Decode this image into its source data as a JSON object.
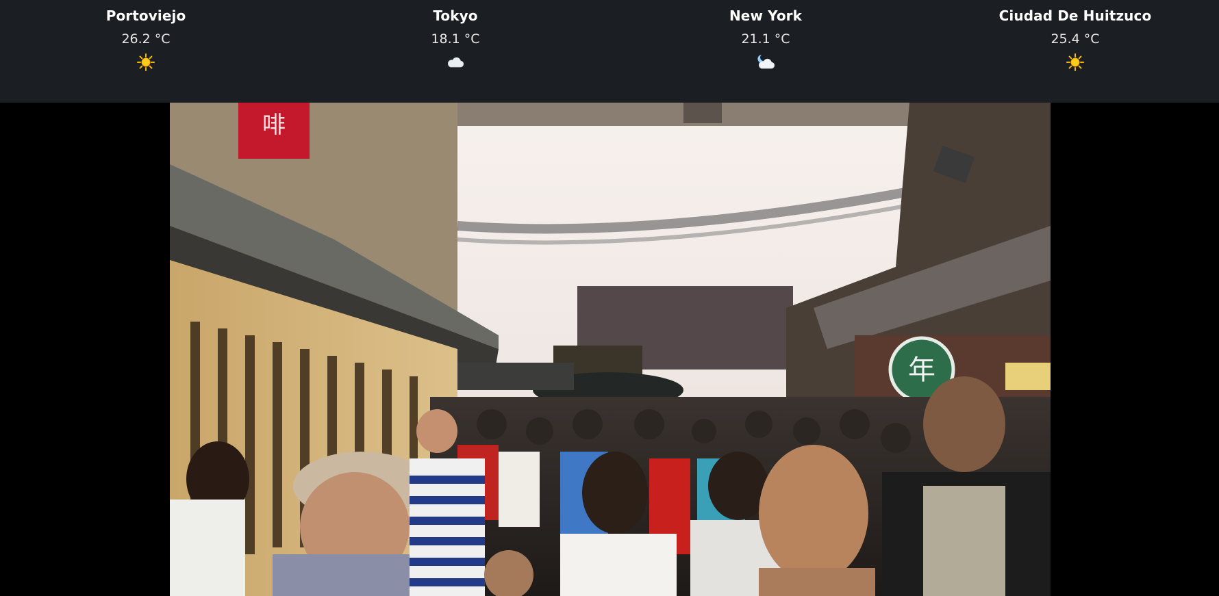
{
  "weather": {
    "cities": [
      {
        "name": "Portoviejo",
        "temp": "26.2 °C",
        "icon": "sun-icon",
        "icon_color": "#f5b800"
      },
      {
        "name": "Tokyo",
        "temp": "18.1 °C",
        "icon": "cloud-icon",
        "icon_color": "#e9eef2"
      },
      {
        "name": "New York",
        "temp": "21.1 °C",
        "icon": "moon-cloud-icon",
        "icon_color": "#e9eef2"
      },
      {
        "name": "Ciudad De Huitzuco",
        "temp": "25.4 °C",
        "icon": "sun-icon",
        "icon_color": "#f5b800"
      }
    ]
  },
  "photo": {
    "subject": "busy-pedestrian-street-photo",
    "sign_text": "啡"
  },
  "colors": {
    "bar_background": "#1b1e22",
    "page_background": "#000000",
    "text": "#ffffff"
  }
}
